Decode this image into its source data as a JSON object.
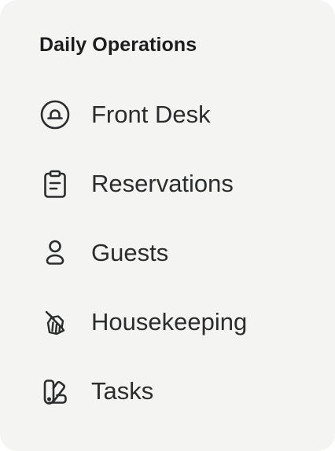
{
  "sidebar": {
    "section_title": "Daily Operations",
    "items": [
      {
        "label": "Front Desk",
        "icon": "concierge-bell-icon"
      },
      {
        "label": "Reservations",
        "icon": "clipboard-icon"
      },
      {
        "label": "Guests",
        "icon": "user-icon"
      },
      {
        "label": "Housekeeping",
        "icon": "broom-icon"
      },
      {
        "label": "Tasks",
        "icon": "swatches-icon"
      }
    ]
  },
  "colors": {
    "panel_background": "#f4f5f3",
    "text": "#2b2c2e",
    "icon_stroke": "#2b2c2e"
  }
}
